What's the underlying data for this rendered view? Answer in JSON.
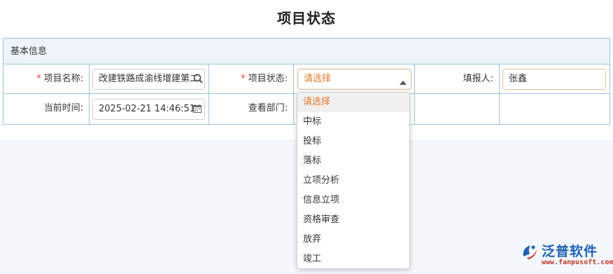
{
  "title": "项目状态",
  "section_title": "基本信息",
  "fields": {
    "project_name": {
      "label": "项目名称:",
      "required_mark": "*",
      "value": "改建铁路成渝线增建第二"
    },
    "project_status": {
      "label": "项目状态:",
      "required_mark": "*",
      "value": "请选择"
    },
    "reporter": {
      "label": "填报人:",
      "value": "张鑫"
    },
    "current_time": {
      "label": "当前时间:",
      "value": "2025-02-21 14:46:51"
    },
    "view_department": {
      "label": "查看部门:"
    }
  },
  "dropdown": {
    "options": [
      {
        "label": "请选择",
        "selected": true
      },
      {
        "label": "中标"
      },
      {
        "label": "投标"
      },
      {
        "label": "落标"
      },
      {
        "label": "立项分析"
      },
      {
        "label": "信息立项"
      },
      {
        "label": "资格审查"
      },
      {
        "label": "放弃"
      },
      {
        "label": "竣工"
      }
    ]
  },
  "logo": {
    "text": "泛普软件",
    "url": "www.fanpusoft.com"
  },
  "icons": {
    "search": "search-icon",
    "calendar": "calendar-icon",
    "caret": "caret-up-icon",
    "logo": "fanpu-logo-icon"
  },
  "colors": {
    "border": "#9cc3e0",
    "header_bg": "#eef4fa",
    "required": "#e4393c",
    "select_text": "#e07a2e",
    "logo_blue": "#1e62b4",
    "logo_red": "#c0392b"
  }
}
